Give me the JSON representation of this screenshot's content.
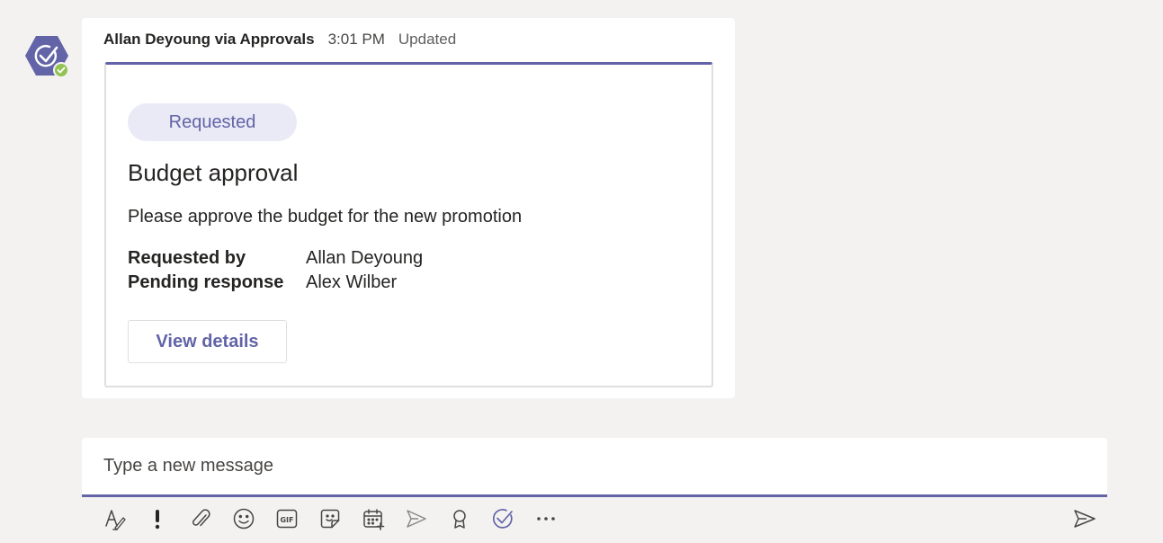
{
  "message": {
    "sender": "Allan Deyoung via Approvals",
    "time": "3:01 PM",
    "edited": "Updated"
  },
  "card": {
    "status": "Requested",
    "title": "Budget approval",
    "description": "Please approve the budget for the new promotion",
    "facts": [
      {
        "label": "Requested by",
        "value": "Allan Deyoung"
      },
      {
        "label": "Pending response",
        "value": "Alex Wilber"
      }
    ],
    "action_label": "View details"
  },
  "compose": {
    "placeholder": "Type a new message"
  },
  "toolbar": {
    "icons": [
      "format-icon",
      "important-icon",
      "attach-icon",
      "emoji-icon",
      "gif-icon",
      "sticker-icon",
      "meet-icon",
      "stream-icon",
      "praise-icon",
      "approvals-icon",
      "more-options-icon"
    ],
    "send_icon": "send-icon"
  },
  "colors": {
    "accent": "#6264a7",
    "pill_background": "#e9eaf6",
    "presence": "#92c353",
    "app_background": "#f3f2f1"
  }
}
